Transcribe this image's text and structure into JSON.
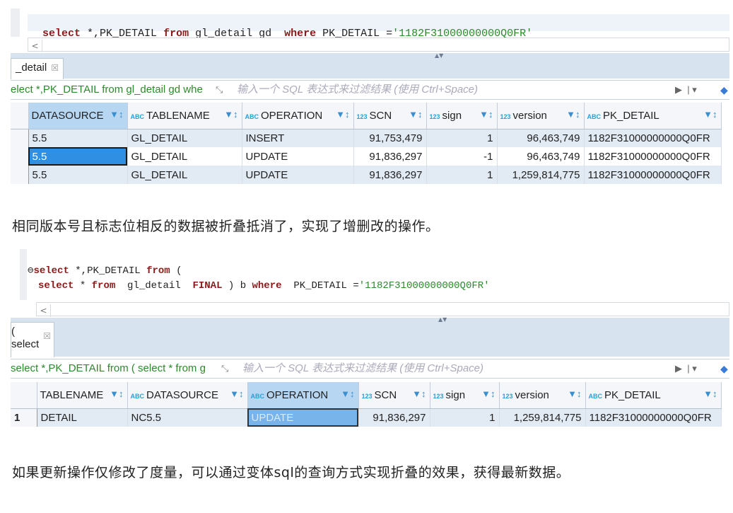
{
  "shot1": {
    "sql": {
      "kw1": "select",
      "t1": " *,PK_DETAIL ",
      "kw2": "from",
      "t2": " gl_detail gd  ",
      "kw3": "where",
      "t3": " PK_DETAIL =",
      "str": "'1182F31000000000Q0FR'"
    },
    "scroll_left": "<",
    "tab": {
      "label": "_detail",
      "close": "☒"
    },
    "filter": {
      "query": "elect *,PK_DETAIL from gl_detail gd whe",
      "placeholder": "输入一个 SQL 表达式来过滤结果 (使用 Ctrl+Space)"
    },
    "columns": [
      {
        "type": "",
        "name": "DATASOURCE"
      },
      {
        "type": "ABC",
        "name": "TABLENAME"
      },
      {
        "type": "ABC",
        "name": "OPERATION"
      },
      {
        "type": "123",
        "name": "SCN"
      },
      {
        "type": "123",
        "name": "sign"
      },
      {
        "type": "123",
        "name": "version"
      },
      {
        "type": "ABC",
        "name": "PK_DETAIL"
      }
    ],
    "rows": [
      [
        "5.5",
        "GL_DETAIL",
        "INSERT",
        "91,753,479",
        "1",
        "96,463,749",
        "1182F31000000000Q0FR"
      ],
      [
        "5.5",
        "GL_DETAIL",
        "UPDATE",
        "91,836,297",
        "-1",
        "96,463,749",
        "1182F31000000000Q0FR"
      ],
      [
        "5.5",
        "GL_DETAIL",
        "UPDATE",
        "91,836,297",
        "1",
        "1,259,814,775",
        "1182F31000000000Q0FR"
      ]
    ]
  },
  "para1": "相同版本号且标志位相反的数据被折叠抵消了，实现了增删改的操作。",
  "shot2": {
    "sql": {
      "l1kw1": "select",
      "l1t1": " *,PK_DETAIL ",
      "l1kw2": "from",
      "l1t2": " (",
      "l2kw1": "select",
      "l2t1": " * ",
      "l2kw2": "from",
      "l2t2": "  gl_detail  ",
      "l2kw3": "FINAL",
      "l2t3": " ) b ",
      "l2kw4": "where",
      "l2t4": "  PK_DETAIL =",
      "str": "'1182F31000000000Q0FR'"
    },
    "scroll_left": "<",
    "tab": {
      "line1": "(",
      "line2": "select",
      "close": "☒"
    },
    "filter": {
      "query": "select *,PK_DETAIL from ( select * from g",
      "placeholder": "输入一个 SQL 表达式来过滤结果 (使用 Ctrl+Space)"
    },
    "columns": [
      {
        "type": "",
        "name": "TABLENAME"
      },
      {
        "type": "ABC",
        "name": "DATASOURCE"
      },
      {
        "type": "ABC",
        "name": "OPERATION"
      },
      {
        "type": "123",
        "name": "SCN"
      },
      {
        "type": "123",
        "name": "sign"
      },
      {
        "type": "123",
        "name": "version"
      },
      {
        "type": "ABC",
        "name": "PK_DETAIL"
      }
    ],
    "rows": [
      [
        "1",
        "DETAIL",
        "NC5.5",
        "UPDATE",
        "91,836,297",
        "1",
        "1,259,814,775",
        "1182F31000000000Q0FR"
      ]
    ]
  },
  "para2": "如果更新操作仅修改了度量，可以通过变体sql的查询方式实现折叠的效果，获得最新数据。"
}
